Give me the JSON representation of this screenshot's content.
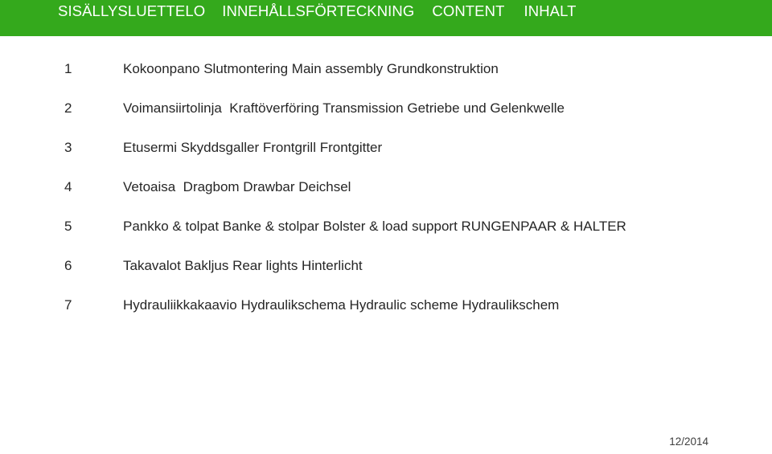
{
  "theme": {
    "header_background": "#34a91c",
    "header_text_color": "#ffffff",
    "body_background": "#ffffff",
    "body_text_color": "#262626",
    "footer_text_color": "#3f3f3f"
  },
  "header": {
    "titles": [
      {
        "label": "SISÄLLYSLUETTELO",
        "language": "fi"
      },
      {
        "label": "INNEHÅLLSFÖRTECKNING",
        "language": "sv"
      },
      {
        "label": "CONTENT",
        "language": "en"
      },
      {
        "label": "INHALT",
        "language": "de"
      }
    ]
  },
  "contents": {
    "items": [
      {
        "number": "1",
        "label": "Kokoonpano Slutmontering Main assembly Grundkonstruktion"
      },
      {
        "number": "2",
        "label": "Voimansiirtolinja  Kraftöverföring Transmission Getriebe und Gelenkwelle"
      },
      {
        "number": "3",
        "label": "Etusermi Skyddsgaller Frontgrill Frontgitter"
      },
      {
        "number": "4",
        "label": "Vetoaisa  Dragbom Drawbar Deichsel"
      },
      {
        "number": "5",
        "label": "Pankko & tolpat Banke & stolpar Bolster & load support RUNGENPAAR & HALTER"
      },
      {
        "number": "6",
        "label": "Takavalot Bakljus Rear lights Hinterlicht"
      },
      {
        "number": "7",
        "label": "Hydrauliikkakaavio Hydraulikschema Hydraulic scheme Hydraulikschem"
      }
    ]
  },
  "footer": {
    "date": "12/2014"
  }
}
